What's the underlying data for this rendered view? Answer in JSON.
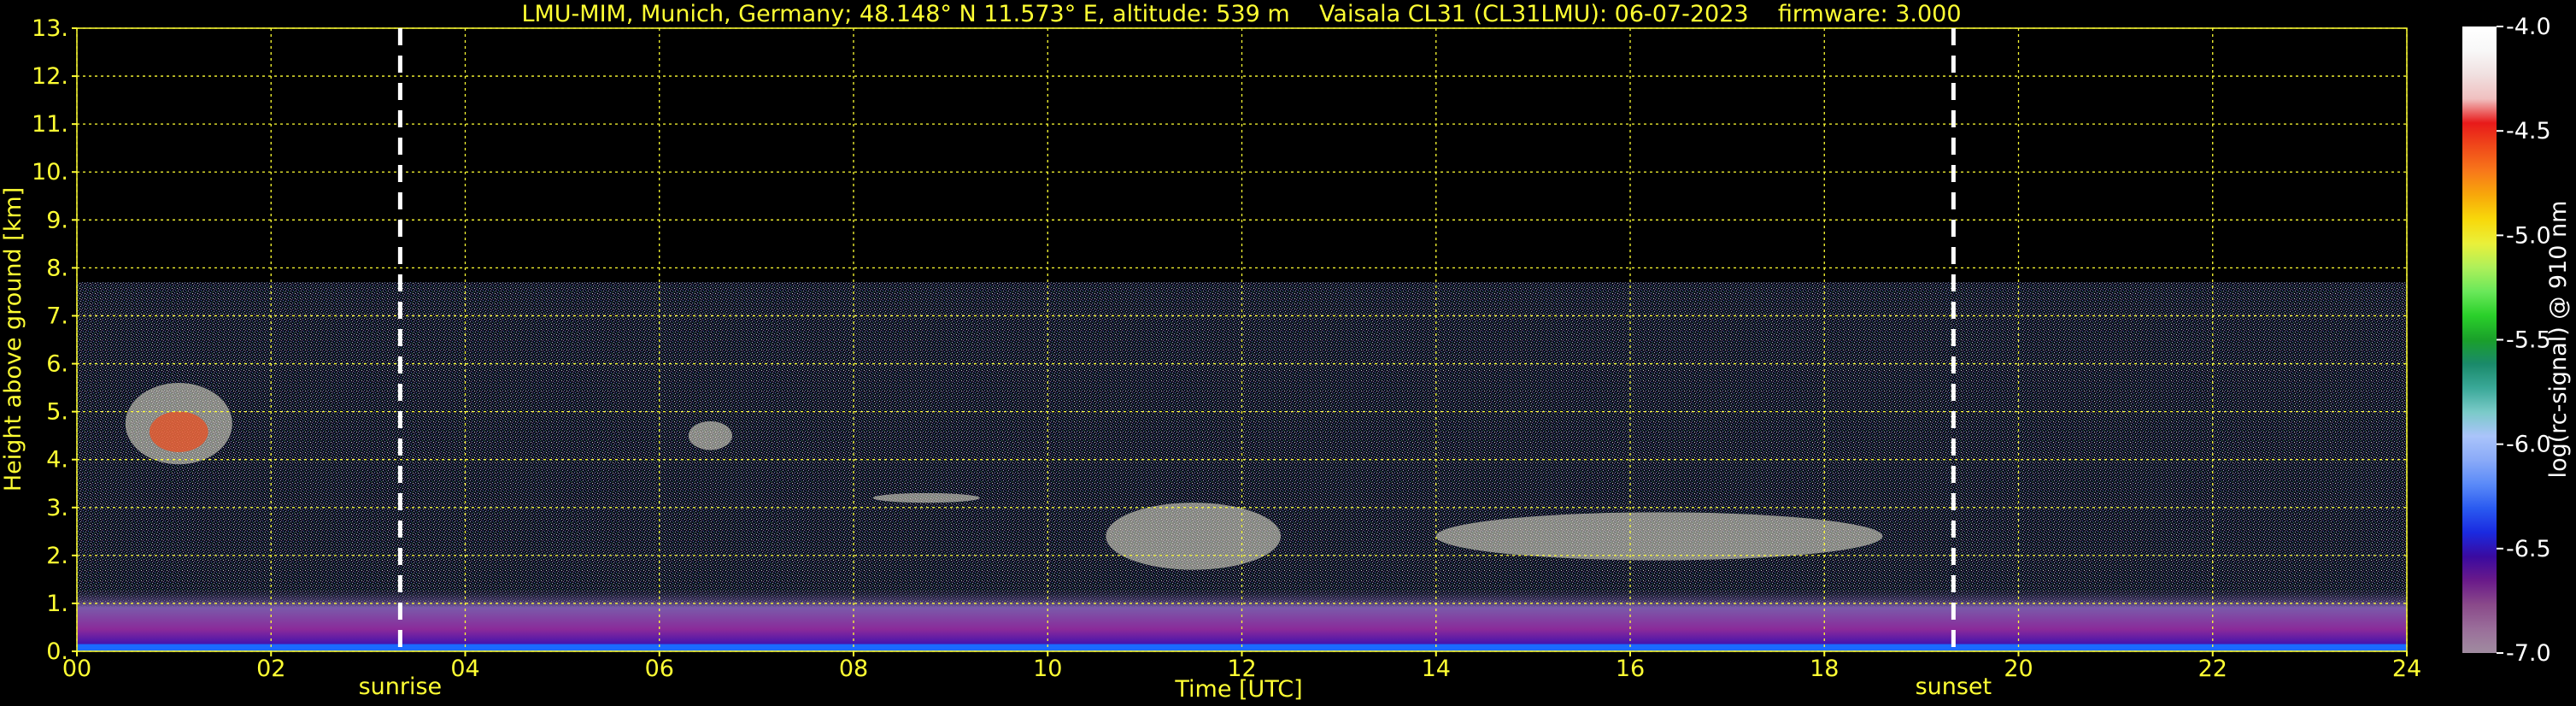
{
  "chart_data": {
    "type": "heatmap",
    "title": "LMU-MIM, Munich, Germany; 48.148° N 11.573° E, altitude: 539 m    Vaisala CL31 (CL31LMU): 06-07-2023    firmware: 3.000",
    "xlabel": "Time [UTC]",
    "ylabel": "Height above ground [km]",
    "xlim": [
      0,
      24
    ],
    "ylim": [
      0,
      13
    ],
    "x_ticks": [
      "00",
      "02",
      "04",
      "06",
      "08",
      "10",
      "12",
      "14",
      "16",
      "18",
      "20",
      "22",
      "24"
    ],
    "y_ticks": [
      "0.",
      "1.",
      "2.",
      "3.",
      "4.",
      "5.",
      "6.",
      "7.",
      "8.",
      "9.",
      "10.",
      "11.",
      "12.",
      "13."
    ],
    "grid": true,
    "grid_color": "#ffff33",
    "data_top_km": 7.7,
    "markers": [
      {
        "label": "sunrise",
        "time": 3.33
      },
      {
        "label": "sunset",
        "time": 19.33
      }
    ],
    "colorbar": {
      "label": "log(rc-signal) @ 910 nm",
      "min": -7.0,
      "max": -4.0,
      "ticks": [
        "-4.0",
        "-4.5",
        "-5.0",
        "-5.5",
        "-6.0",
        "-6.5",
        "-7.0"
      ],
      "colors": [
        "#a08ca0",
        "#9a6e9a",
        "#8a4a8a",
        "#6a1a8a",
        "#3a0aa0",
        "#1a2ae0",
        "#2a5af0",
        "#5a8af8",
        "#8aaaf8",
        "#aac4fa",
        "#7acac8",
        "#3aa898",
        "#1a8a6a",
        "#1aa02a",
        "#2ad02a",
        "#6ae85a",
        "#aef05a",
        "#eaf03a",
        "#f8d80a",
        "#f8a80a",
        "#f8781a",
        "#f04a1a",
        "#e81a1a",
        "#f0c0c0",
        "#f0e0e0",
        "#f8f8f8",
        "#ffffff"
      ]
    },
    "features": [
      {
        "kind": "cloud",
        "t_start": 0.5,
        "t_end": 1.6,
        "h_low_km": 3.9,
        "h_high_km": 5.6
      },
      {
        "kind": "cloud",
        "t_start": 6.3,
        "t_end": 6.75,
        "h_low_km": 4.2,
        "h_high_km": 4.8
      },
      {
        "kind": "cloud",
        "t_start": 8.2,
        "t_end": 9.3,
        "h_low_km": 3.1,
        "h_high_km": 3.3
      },
      {
        "kind": "cloud",
        "t_start": 10.6,
        "t_end": 12.4,
        "h_low_km": 1.7,
        "h_high_km": 3.1
      },
      {
        "kind": "cloud",
        "t_start": 14.0,
        "t_end": 18.6,
        "h_low_km": 1.9,
        "h_high_km": 2.9
      }
    ]
  }
}
